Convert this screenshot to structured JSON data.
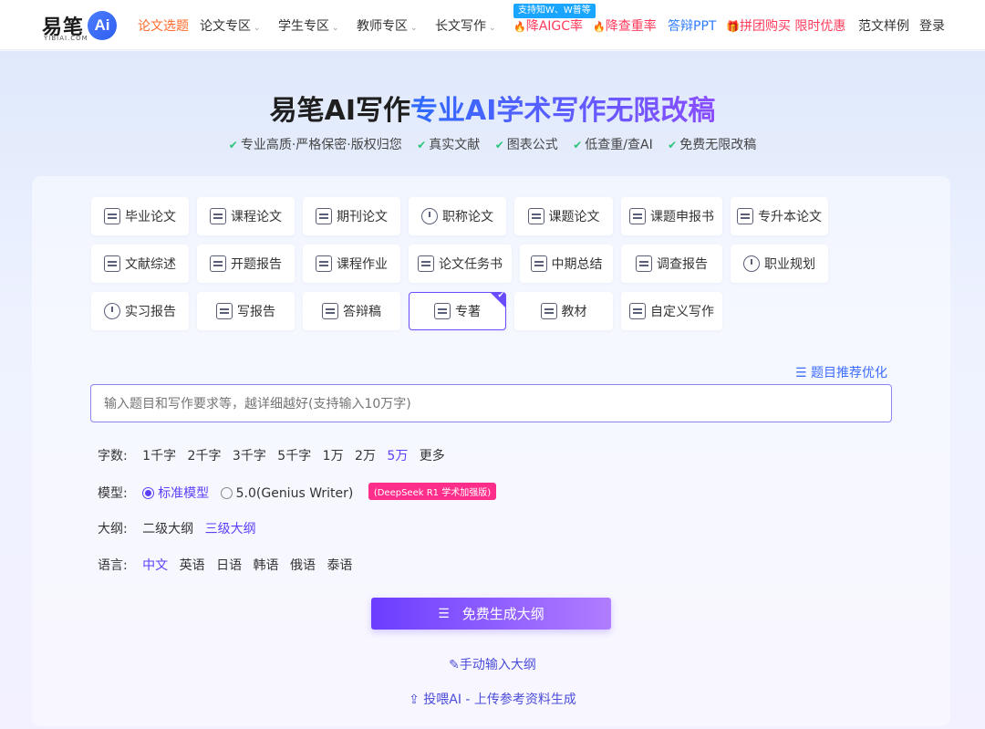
{
  "nav": {
    "logo_text": "易笔",
    "logo_badge": "Ai",
    "logo_sub": "YIBIAI.COM",
    "items": [
      {
        "label": "论文选题"
      },
      {
        "label": "论文专区"
      },
      {
        "label": "学生专区"
      },
      {
        "label": "教师专区"
      },
      {
        "label": "长文写作"
      },
      {
        "label": "降AIGC率"
      },
      {
        "label": "降查重率"
      },
      {
        "label": "答辩PPT"
      },
      {
        "label": "拼团购买 限时优惠"
      },
      {
        "label": "范文样例"
      },
      {
        "label": "登录"
      }
    ],
    "promo_tag": "支持知W、W普等",
    "caret": "⌄",
    "fire_icon": "🔥",
    "gift_icon": "🎁",
    "accent": "#ff6a2a"
  },
  "hero": {
    "title_plain": "易笔AI写作",
    "title_grad": "专业AI学术写作无限改稿",
    "features": [
      "专业高质·严格保密·版权归您",
      "真实文献",
      "图表公式",
      "低查重/查AI",
      "免费无限改稿"
    ],
    "check": "✔"
  },
  "types": [
    {
      "label": "毕业论文",
      "icon": "graduation-cap-icon"
    },
    {
      "label": "课程论文",
      "icon": "document-icon"
    },
    {
      "label": "期刊论文",
      "icon": "journal-icon"
    },
    {
      "label": "职称论文",
      "icon": "shield-icon"
    },
    {
      "label": "课题论文",
      "icon": "bookmark-icon"
    },
    {
      "label": "课题申报书",
      "icon": "clipboard-icon"
    },
    {
      "label": "专升本论文",
      "icon": "edit-doc-icon"
    },
    {
      "label": "文献综述",
      "icon": "document-icon"
    },
    {
      "label": "开题报告",
      "icon": "report-icon"
    },
    {
      "label": "课程作业",
      "icon": "search-doc-icon"
    },
    {
      "label": "论文任务书",
      "icon": "clipboard-icon"
    },
    {
      "label": "中期总结",
      "icon": "clipboard-icon"
    },
    {
      "label": "调查报告",
      "icon": "report-icon"
    },
    {
      "label": "职业规划",
      "icon": "clock-icon"
    },
    {
      "label": "实习报告",
      "icon": "person-icon"
    },
    {
      "label": "写报告",
      "icon": "edit-doc-icon"
    },
    {
      "label": "答辩稿",
      "icon": "checklist-icon"
    },
    {
      "label": "专著",
      "icon": "book-icon"
    },
    {
      "label": "教材",
      "icon": "open-book-icon"
    },
    {
      "label": "自定义写作",
      "icon": "sliders-icon"
    }
  ],
  "selected_type": "专著",
  "suggest_label": "题目推荐优化",
  "input": {
    "placeholder": "输入题目和写作要求等，越详细越好(支持输入10万字)",
    "value": ""
  },
  "options": {
    "words": {
      "label": "字数:",
      "items": [
        "1千字",
        "2千字",
        "3千字",
        "5千字",
        "1万",
        "2万",
        "5万",
        "更多"
      ],
      "selected": "5万"
    },
    "model": {
      "label": "模型:",
      "items": [
        "标准模型",
        "5.0(Genius Writer)"
      ],
      "selected": "标准模型",
      "badge": "(DeepSeek R1 学术加强版)"
    },
    "outline": {
      "label": "大纲:",
      "items": [
        "二级大纲",
        "三级大纲"
      ],
      "selected": "三级大纲"
    },
    "language": {
      "label": "语言:",
      "items": [
        "中文",
        "英语",
        "日语",
        "韩语",
        "俄语",
        "泰语"
      ],
      "selected": "中文"
    }
  },
  "generate_label": "免费生成大纲",
  "manual_label": "手动输入大纲",
  "upload_label": "投喂AI - 上传参考资料生成",
  "colors": {
    "primary": "#5a3ff6",
    "link": "#3c6cff",
    "red": "#ff3b5c",
    "badge": "#ff2e8a"
  }
}
